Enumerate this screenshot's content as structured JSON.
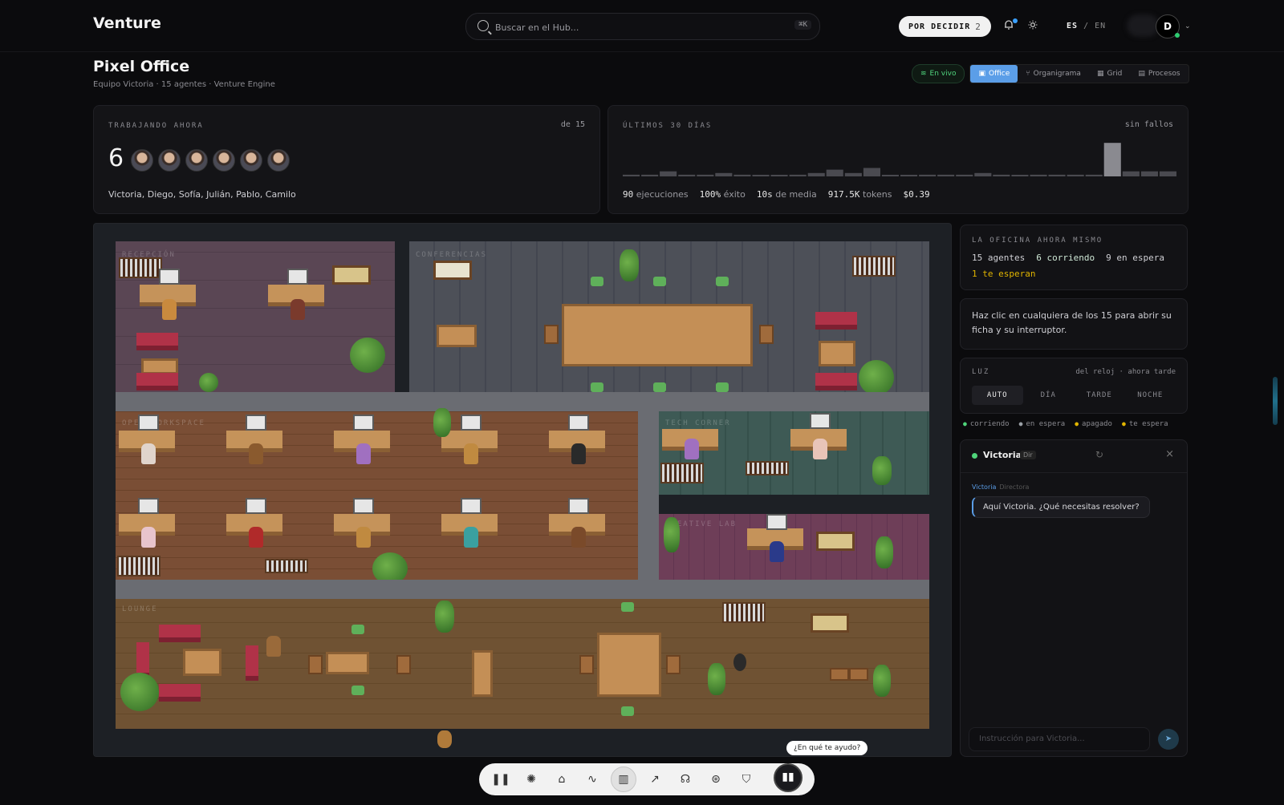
{
  "header": {
    "brand": "Venture",
    "search_placeholder": "Buscar en el Hub...",
    "search_shortcut": "⌘K",
    "decide_label": "POR DECIDIR",
    "decide_count": "2",
    "lang_active": "ES",
    "lang_sep": "/",
    "lang_other": "EN",
    "user_initial": "D"
  },
  "page": {
    "title": "Pixel Office",
    "subtitle": "Equipo Victoria · 15 agentes · Venture Engine",
    "live_label": "En vivo",
    "views": [
      "Office",
      "Organigrama",
      "Grid",
      "Procesos"
    ],
    "active_view": "Office"
  },
  "working": {
    "label": "TRABAJANDO AHORA",
    "of_total": "de 15",
    "count": "6",
    "names": "Victoria, Diego, Sofía, Julián, Pablo, Camilo"
  },
  "last30": {
    "label": "ÚLTIMOS 30 DÍAS",
    "status": "sin fallos",
    "exec_value": "90",
    "exec_label": "ejecuciones",
    "success_value": "100%",
    "success_label": "éxito",
    "avg_value": "10s",
    "avg_label": "de media",
    "tokens_value": "917.5K",
    "tokens_label": "tokens",
    "cost_value": "$0.39"
  },
  "chart_data": {
    "type": "bar",
    "categories": [
      "1",
      "2",
      "3",
      "4",
      "5",
      "6",
      "7",
      "8",
      "9",
      "10",
      "11",
      "12",
      "13",
      "14",
      "15",
      "16",
      "17",
      "18",
      "19",
      "20",
      "21",
      "22",
      "23",
      "24",
      "25",
      "26",
      "27",
      "28",
      "29",
      "30"
    ],
    "values": [
      1,
      1,
      3,
      1,
      1,
      2,
      1,
      0,
      0,
      1,
      2,
      4,
      2,
      5,
      0,
      0,
      1,
      1,
      1,
      2,
      1,
      0,
      1,
      1,
      1,
      1,
      20,
      3,
      3,
      3
    ],
    "ylim": [
      0,
      22
    ]
  },
  "office": {
    "rooms": [
      "RECEPCIÓN",
      "CONFERENCIAS",
      "OPEN WORKSPACE",
      "TECH CORNER",
      "CREATIVE LAB",
      "LOUNGE"
    ]
  },
  "panel": {
    "now_label": "LA OFICINA AHORA MISMO",
    "agents": "15 agentes",
    "running": "6 corriendo",
    "waiting": "9 en espera",
    "pending": "1 te esperan",
    "hint": "Haz clic en cualquiera de los 15 para abrir su ficha y su interruptor.",
    "luz_label": "LUZ",
    "luz_status": "del reloj · ahora tarde",
    "luz_options": [
      "AUTO",
      "DÍA",
      "TARDE",
      "NOCHE"
    ],
    "luz_active": "AUTO",
    "legend": [
      "corriendo",
      "en espera",
      "apagado",
      "te espera"
    ]
  },
  "chat": {
    "agent_name": "Victoria",
    "agent_tag": "Dir",
    "msg_author": "Victoria",
    "msg_role": "Directora",
    "msg_text": "Aquí Victoria. ¿Qué necesitas resolver?",
    "input_placeholder": "Instrucción para Victoria..."
  },
  "dock": {
    "tooltip": "¿En qué te ayudo?",
    "items": [
      "pause-icon",
      "brain-icon",
      "home-icon",
      "pulse-icon",
      "office-icon",
      "trend-icon",
      "headset-icon",
      "lifebuoy-icon",
      "shield-icon"
    ]
  }
}
